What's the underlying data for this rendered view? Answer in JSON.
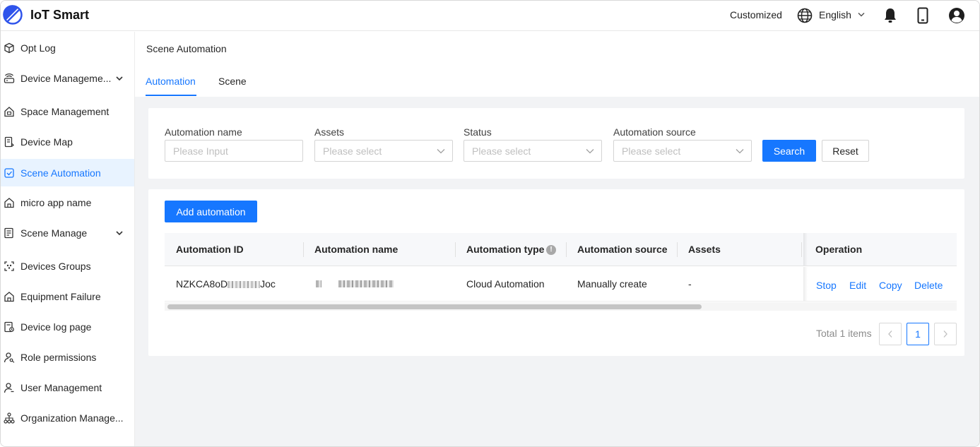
{
  "app": {
    "title": "IoT Smart",
    "accent": "#1677ff"
  },
  "topbar": {
    "customized": "Customized",
    "language": "English",
    "icons": [
      "globe-icon",
      "bell-icon",
      "phone-icon",
      "user-avatar-icon"
    ]
  },
  "sidebar": {
    "items": [
      {
        "label": "Opt Log",
        "icon": "cube-icon"
      },
      {
        "label": "Device Manageme...",
        "icon": "router-icon",
        "expandable": true
      },
      {
        "label": "Space Management",
        "icon": "house-icon"
      },
      {
        "label": "Device Map",
        "icon": "map-icon"
      },
      {
        "label": "Scene Automation",
        "icon": "scene-icon",
        "active": true
      },
      {
        "label": "micro app name",
        "icon": "home-outline-icon"
      },
      {
        "label": "Scene Manage",
        "icon": "list-icon",
        "expandable": true
      },
      {
        "label": "Devices Groups",
        "icon": "group-icon"
      },
      {
        "label": "Equipment Failure",
        "icon": "home-outline-icon"
      },
      {
        "label": "Device log page",
        "icon": "log-icon"
      },
      {
        "label": "Role permissions",
        "icon": "user-key-icon"
      },
      {
        "label": "User Management",
        "icon": "user-icon"
      },
      {
        "label": "Organization Manage...",
        "icon": "org-icon"
      }
    ],
    "collapse": "«"
  },
  "main": {
    "title": "Scene Automation",
    "tabs": [
      {
        "label": "Automation",
        "active": true
      },
      {
        "label": "Scene",
        "active": false
      }
    ]
  },
  "filters": {
    "automation_name": {
      "label": "Automation name",
      "placeholder": "Please Input"
    },
    "assets": {
      "label": "Assets",
      "placeholder": "Please select"
    },
    "status": {
      "label": "Status",
      "placeholder": "Please select"
    },
    "automation_source": {
      "label": "Automation source",
      "placeholder": "Please select"
    },
    "search": "Search",
    "reset": "Reset"
  },
  "list": {
    "add_button": "Add automation",
    "columns": [
      "Automation ID",
      "Automation name",
      "Automation type",
      "Automation source",
      "Assets",
      "Operation"
    ],
    "rows": [
      {
        "id_prefix": "NZKCA8oD",
        "id_suffix": "Joc",
        "type": "Cloud Automation",
        "source": "Manually create",
        "assets": "-",
        "actions": [
          "Stop",
          "Edit",
          "Copy",
          "Delete"
        ]
      }
    ],
    "total": "Total 1 items",
    "current_page": "1",
    "prev": "<",
    "next": ">"
  }
}
